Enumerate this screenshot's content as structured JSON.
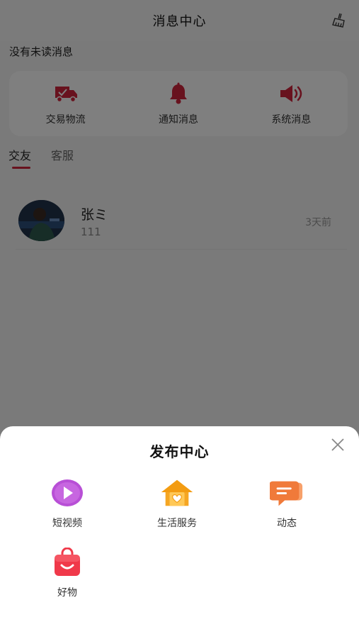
{
  "header": {
    "title": "消息中心",
    "clean_icon": "broom-icon"
  },
  "unread_text": "没有未读消息",
  "categories": [
    {
      "label": "交易物流",
      "icon": "delivery-truck-icon",
      "color": "#d0243c"
    },
    {
      "label": "通知消息",
      "icon": "bell-icon",
      "color": "#d0243c"
    },
    {
      "label": "系统消息",
      "icon": "speaker-icon",
      "color": "#d0243c"
    }
  ],
  "tabs": [
    {
      "label": "交友",
      "active": true
    },
    {
      "label": "客服",
      "active": false
    }
  ],
  "accent_color": "#d0243c",
  "chats": [
    {
      "name": "张ミ",
      "preview": "111",
      "time": "3天前"
    }
  ],
  "publish_sheet": {
    "title": "发布中心",
    "items": [
      {
        "label": "短视频",
        "icon": "play-video-icon",
        "color": "#b84fd6"
      },
      {
        "label": "生活服务",
        "icon": "house-heart-icon",
        "color": "#f5a623"
      },
      {
        "label": "动态",
        "icon": "chat-bubble-icon",
        "color": "#f07a3a"
      },
      {
        "label": "好物",
        "icon": "shopping-bag-icon",
        "color": "#f0394a"
      }
    ]
  }
}
